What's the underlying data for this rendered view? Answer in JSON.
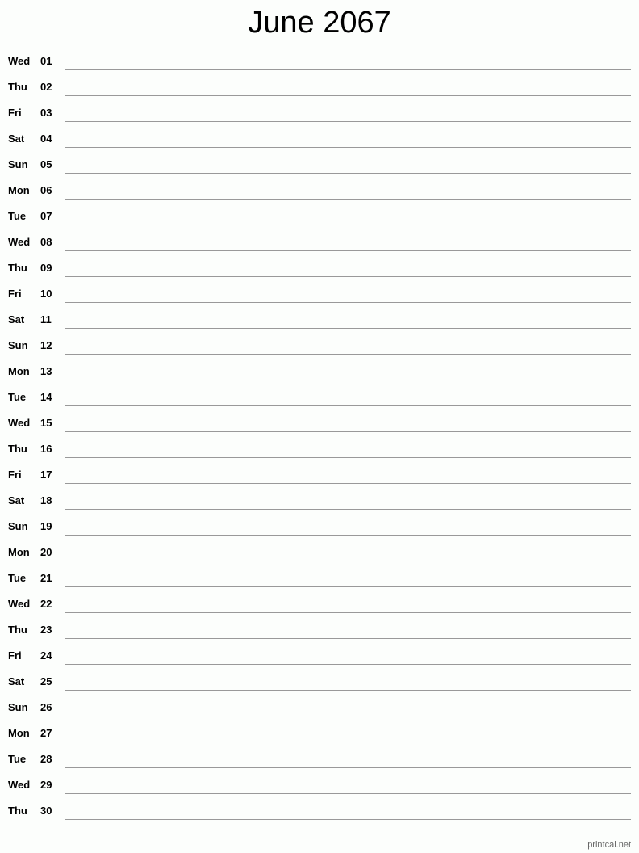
{
  "title": "June 2067",
  "footer": "printcal.net",
  "days": [
    {
      "dow": "Wed",
      "num": "01"
    },
    {
      "dow": "Thu",
      "num": "02"
    },
    {
      "dow": "Fri",
      "num": "03"
    },
    {
      "dow": "Sat",
      "num": "04"
    },
    {
      "dow": "Sun",
      "num": "05"
    },
    {
      "dow": "Mon",
      "num": "06"
    },
    {
      "dow": "Tue",
      "num": "07"
    },
    {
      "dow": "Wed",
      "num": "08"
    },
    {
      "dow": "Thu",
      "num": "09"
    },
    {
      "dow": "Fri",
      "num": "10"
    },
    {
      "dow": "Sat",
      "num": "11"
    },
    {
      "dow": "Sun",
      "num": "12"
    },
    {
      "dow": "Mon",
      "num": "13"
    },
    {
      "dow": "Tue",
      "num": "14"
    },
    {
      "dow": "Wed",
      "num": "15"
    },
    {
      "dow": "Thu",
      "num": "16"
    },
    {
      "dow": "Fri",
      "num": "17"
    },
    {
      "dow": "Sat",
      "num": "18"
    },
    {
      "dow": "Sun",
      "num": "19"
    },
    {
      "dow": "Mon",
      "num": "20"
    },
    {
      "dow": "Tue",
      "num": "21"
    },
    {
      "dow": "Wed",
      "num": "22"
    },
    {
      "dow": "Thu",
      "num": "23"
    },
    {
      "dow": "Fri",
      "num": "24"
    },
    {
      "dow": "Sat",
      "num": "25"
    },
    {
      "dow": "Sun",
      "num": "26"
    },
    {
      "dow": "Mon",
      "num": "27"
    },
    {
      "dow": "Tue",
      "num": "28"
    },
    {
      "dow": "Wed",
      "num": "29"
    },
    {
      "dow": "Thu",
      "num": "30"
    }
  ]
}
